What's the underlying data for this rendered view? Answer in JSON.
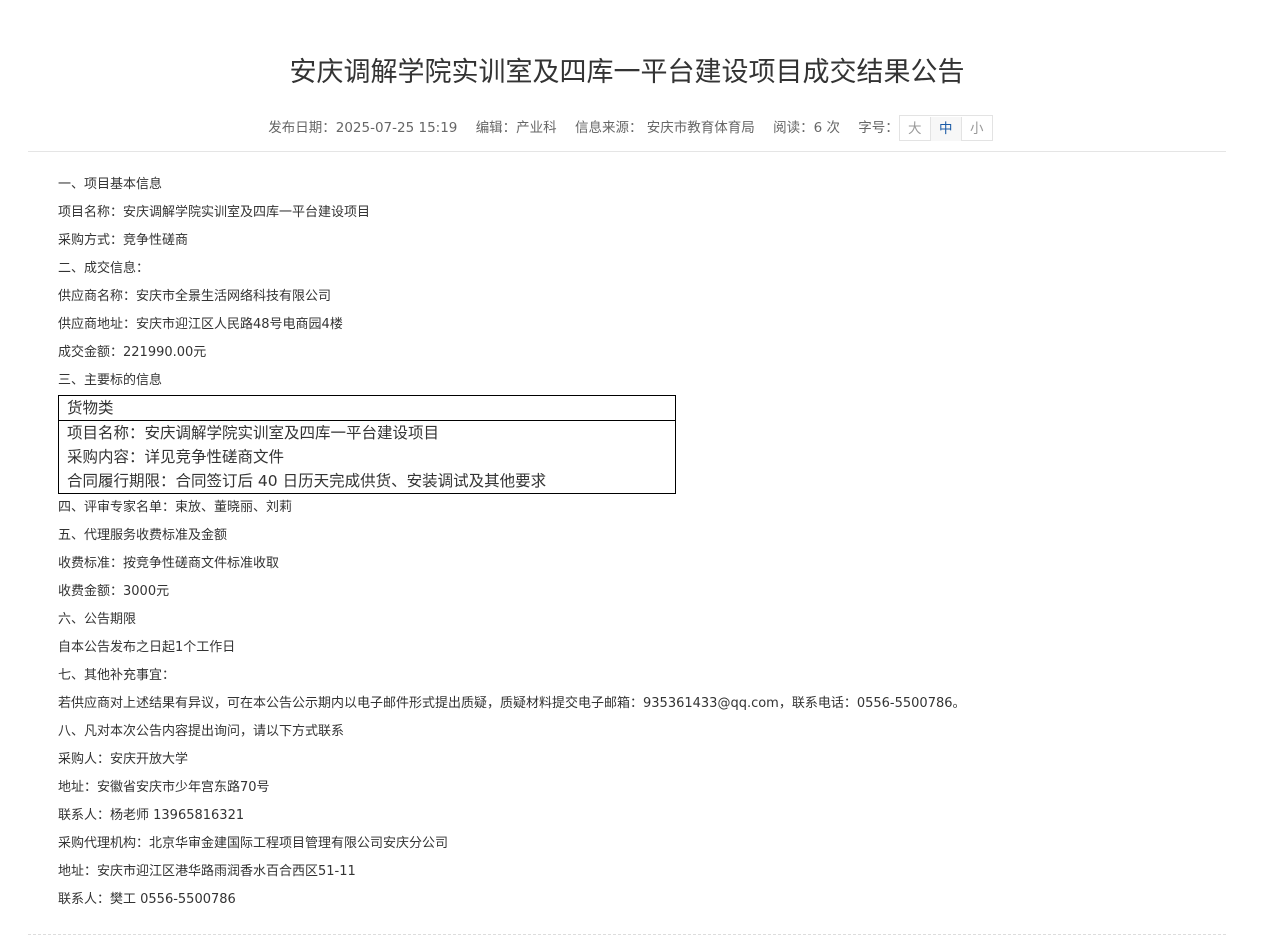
{
  "article": {
    "title": "安庆调解学院实训室及四库一平台建设项目成交结果公告",
    "meta": {
      "publish_date": "发布日期：2025-07-25 15:19",
      "editor": "编辑：产业科",
      "source": "信息来源： 安庆市教育体育局",
      "reads": "阅读：6 次",
      "font_size_label": "字号：",
      "font_sizes": [
        "大",
        "中",
        "小"
      ],
      "selected_font_size": "中"
    },
    "sections_before_table": [
      "一、项目基本信息",
      "项目名称：安庆调解学院实训室及四库一平台建设项目",
      "采购方式：竞争性磋商",
      "二、成交信息：",
      "供应商名称：安庆市全景生活网络科技有限公司",
      "供应商地址：安庆市迎江区人民路48号电商园4楼",
      "成交金额：221990.00元",
      "三、主要标的信息"
    ],
    "table": {
      "header": "货物类",
      "rows": [
        "项目名称：安庆调解学院实训室及四库一平台建设项目",
        "采购内容：详见竞争性磋商文件",
        "合同履行期限：合同签订后 40 日历天完成供货、安装调试及其他要求"
      ]
    },
    "sections_after_table": [
      "四、评审专家名单：束放、董晓丽、刘莉",
      "五、代理服务收费标准及金额",
      "收费标准：按竞争性磋商文件标准收取",
      "收费金额：3000元",
      "六、公告期限",
      "自本公告发布之日起1个工作日",
      "七、其他补充事宜：",
      "若供应商对上述结果有异议，可在本公告公示期内以电子邮件形式提出质疑，质疑材料提交电子邮箱：935361433@qq.com，联系电话：0556-5500786。",
      "八、凡对本次公告内容提出询问，请以下方式联系",
      "采购人：安庆开放大学",
      "地址：安徽省安庆市少年宫东路70号",
      "联系人：杨老师 13965816321",
      "采购代理机构：北京华审金建国际工程项目管理有限公司安庆分公司",
      "地址：安庆市迎江区港华路雨润香水百合西区51-11",
      "联系人：樊工 0556-5500786"
    ]
  }
}
